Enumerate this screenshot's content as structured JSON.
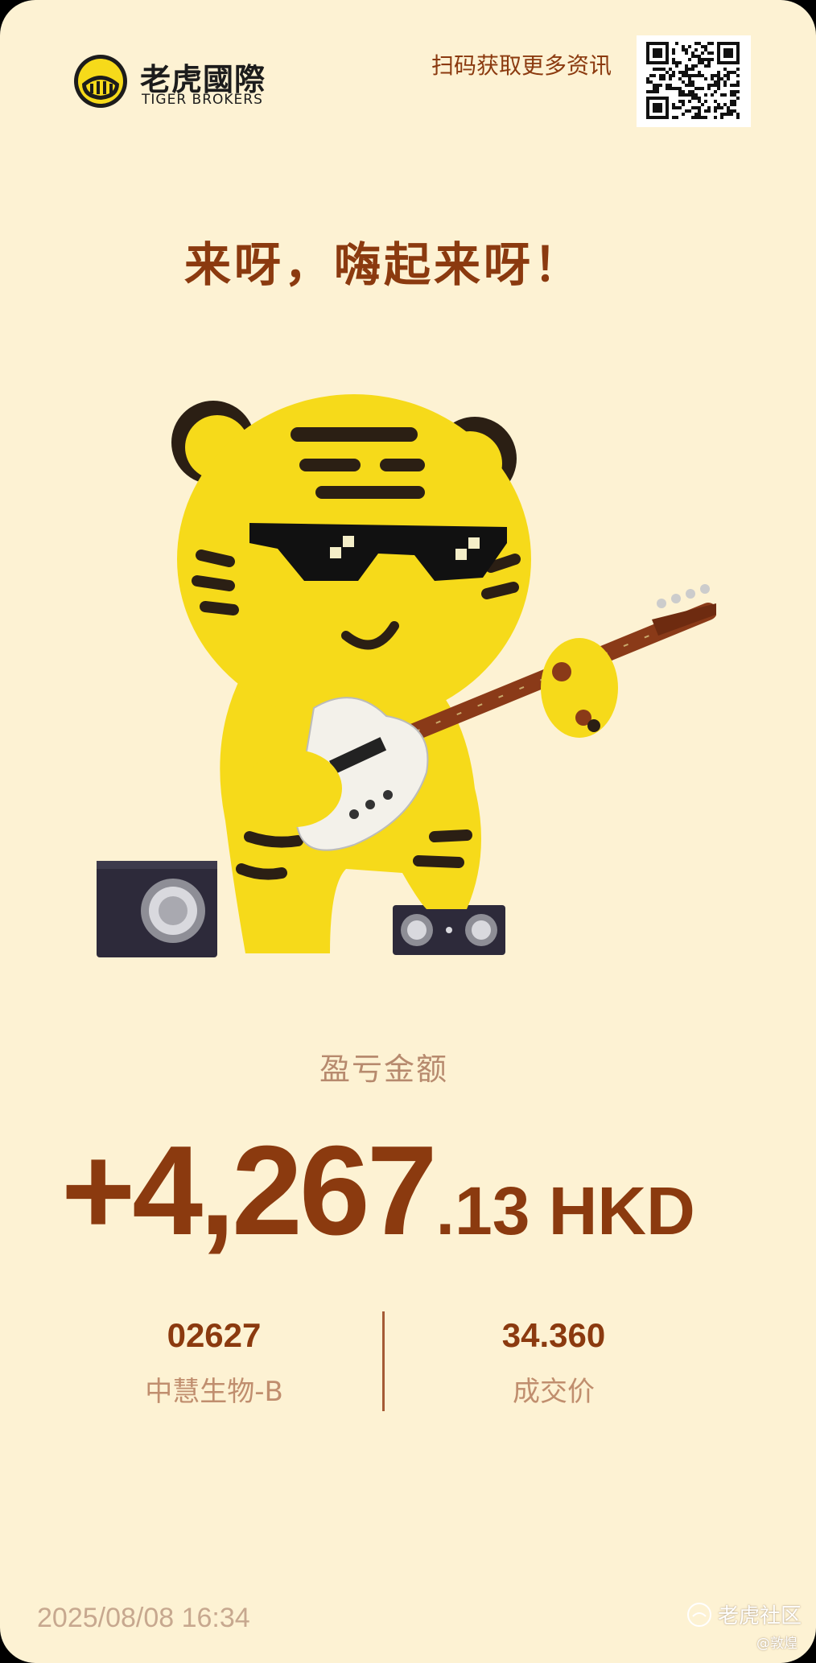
{
  "brand": {
    "name_cn": "老虎國際",
    "name_en": "TIGER BROKERS"
  },
  "qr_prompt": "扫码获取更多资讯",
  "headline": "来呀，嗨起来呀！",
  "pnl": {
    "label": "盈亏金额",
    "amount_main": "+4,267",
    "amount_fraction": ".13 HKD"
  },
  "stock": {
    "code": "02627",
    "name": "中慧生物-B"
  },
  "price": {
    "value": "34.360",
    "label": "成交价"
  },
  "timestamp": "2025/08/08 16:34",
  "watermark": {
    "community": "老虎社区",
    "user": "@敦煌"
  },
  "colors": {
    "background": "#FDF2D3",
    "accent": "#8B3A0F",
    "muted": "#C08E6E",
    "tiger_yellow": "#F6DA1A"
  }
}
